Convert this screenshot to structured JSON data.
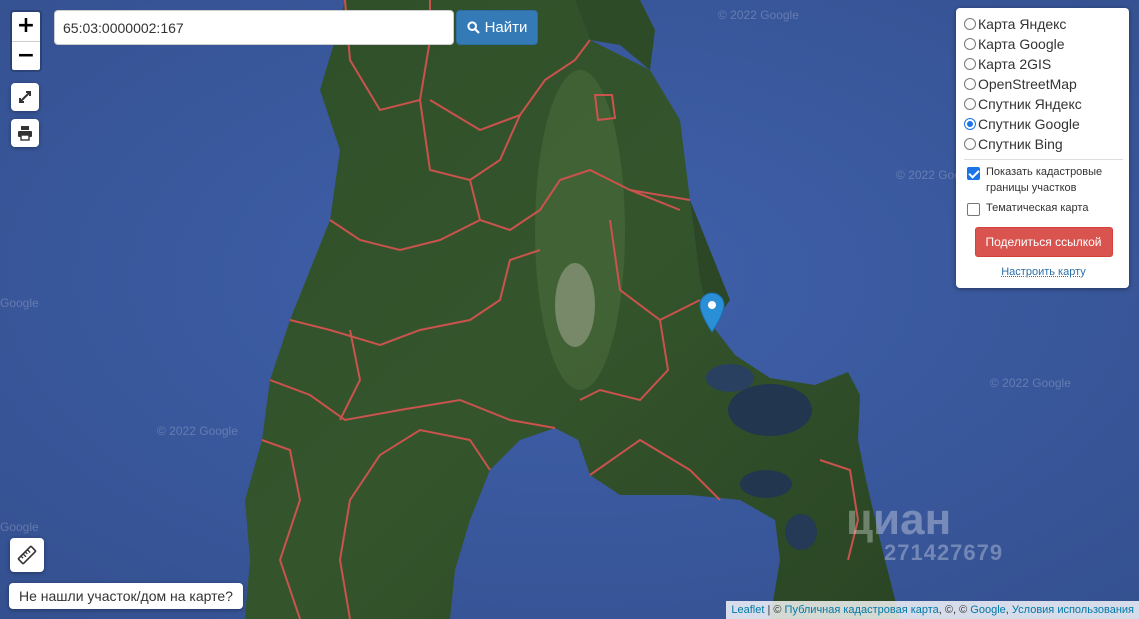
{
  "zoom": {
    "in_label": "+",
    "out_label": "−"
  },
  "search": {
    "value": "65:03:0000002:167",
    "button_label": "Найти"
  },
  "layers": {
    "options": [
      {
        "label": "Карта Яндекс",
        "selected": false
      },
      {
        "label": "Карта Google",
        "selected": false
      },
      {
        "label": "Карта 2GIS",
        "selected": false
      },
      {
        "label": "OpenStreetMap",
        "selected": false
      },
      {
        "label": "Спутник Яндекс",
        "selected": false
      },
      {
        "label": "Спутник Google",
        "selected": true
      },
      {
        "label": "Спутник Bing",
        "selected": false
      }
    ],
    "show_cadastral_label": "Показать кадастровые границы участков",
    "show_cadastral_checked": true,
    "thematic_label": "Тематическая карта",
    "thematic_checked": false,
    "share_label": "Поделиться ссылкой",
    "configure_label": "Настроить карту"
  },
  "not_found_label": "Не нашли участок/дом на карте?",
  "attribution": {
    "leaflet": "Leaflet",
    "sep1": " | © ",
    "cadastral": "Публичная кадастровая карта",
    "sep2": ", ©, © ",
    "google": "Google",
    "sep3": ", ",
    "terms": "Условия использования"
  },
  "watermarks": {
    "google_copyright": "© 2022 Google",
    "google_short": "Google",
    "cian_logo": "циан",
    "cian_id": "271427679"
  },
  "icons": {
    "fullscreen": "expand-icon",
    "print": "printer-icon",
    "ruler": "ruler-icon",
    "search": "search-icon",
    "marker": "map-pin-icon"
  },
  "colors": {
    "sea": "#3b5aa2",
    "land": "#2c4a26",
    "cadastral_border": "#d2534f",
    "find_button": "#337ab7",
    "share_button": "#d9534f",
    "marker": "#2a8fd6"
  }
}
